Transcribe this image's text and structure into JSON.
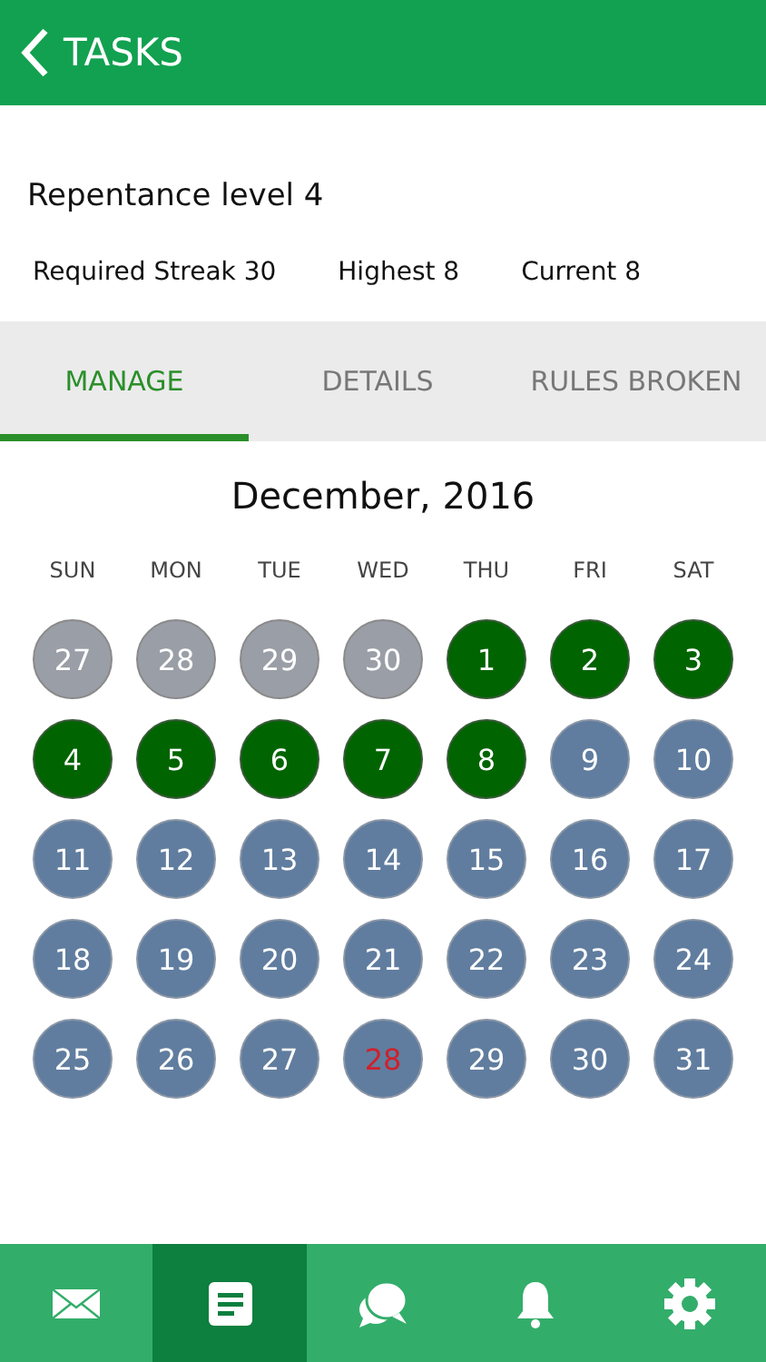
{
  "header": {
    "back_label": "TASKS"
  },
  "level_title": "Repentance level 4",
  "stats": [
    "Required Streak 30",
    "Highest 8",
    "Current 8"
  ],
  "tabs": [
    {
      "label": "MANAGE",
      "selected": true
    },
    {
      "label": "DETAILS",
      "selected": false
    },
    {
      "label": "RULES BROKEN",
      "selected": false
    }
  ],
  "calendar": {
    "month": "December, 2016",
    "weekdays": [
      "SUN",
      "MON",
      "TUE",
      "WED",
      "THU",
      "FRI",
      "SAT"
    ],
    "days": [
      {
        "label": "27",
        "kind": "outside"
      },
      {
        "label": "28",
        "kind": "outside"
      },
      {
        "label": "29",
        "kind": "outside"
      },
      {
        "label": "30",
        "kind": "outside"
      },
      {
        "label": "1",
        "kind": "done"
      },
      {
        "label": "2",
        "kind": "done"
      },
      {
        "label": "3",
        "kind": "done"
      },
      {
        "label": "4",
        "kind": "done"
      },
      {
        "label": "5",
        "kind": "done"
      },
      {
        "label": "6",
        "kind": "done"
      },
      {
        "label": "7",
        "kind": "done"
      },
      {
        "label": "8",
        "kind": "done"
      },
      {
        "label": "9",
        "kind": "open"
      },
      {
        "label": "10",
        "kind": "open"
      },
      {
        "label": "11",
        "kind": "open"
      },
      {
        "label": "12",
        "kind": "open"
      },
      {
        "label": "13",
        "kind": "open"
      },
      {
        "label": "14",
        "kind": "open"
      },
      {
        "label": "15",
        "kind": "open"
      },
      {
        "label": "16",
        "kind": "open"
      },
      {
        "label": "17",
        "kind": "open"
      },
      {
        "label": "18",
        "kind": "open"
      },
      {
        "label": "19",
        "kind": "open"
      },
      {
        "label": "20",
        "kind": "open"
      },
      {
        "label": "21",
        "kind": "open"
      },
      {
        "label": "22",
        "kind": "open"
      },
      {
        "label": "23",
        "kind": "open"
      },
      {
        "label": "24",
        "kind": "open"
      },
      {
        "label": "25",
        "kind": "open"
      },
      {
        "label": "26",
        "kind": "open"
      },
      {
        "label": "27",
        "kind": "open"
      },
      {
        "label": "28",
        "kind": "today"
      },
      {
        "label": "29",
        "kind": "open"
      },
      {
        "label": "30",
        "kind": "open"
      },
      {
        "label": "31",
        "kind": "open"
      }
    ]
  },
  "nav": [
    {
      "kind": "mail",
      "selected": false
    },
    {
      "kind": "tasks",
      "selected": true
    },
    {
      "kind": "chat",
      "selected": false
    },
    {
      "kind": "bell",
      "selected": false
    },
    {
      "kind": "gear",
      "selected": false
    }
  ]
}
